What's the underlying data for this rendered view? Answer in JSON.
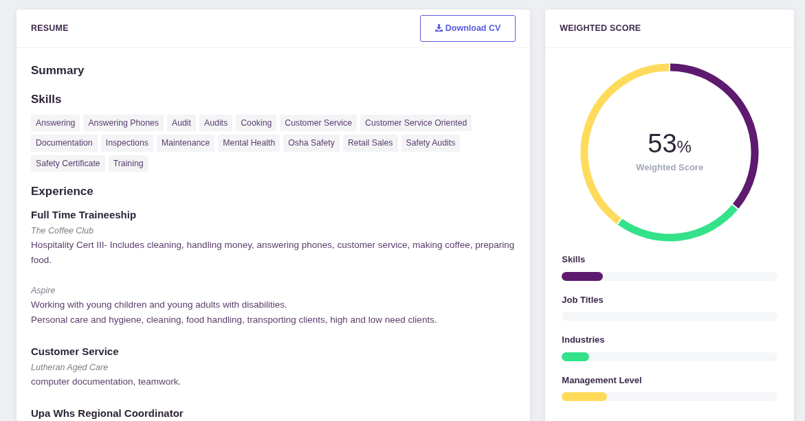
{
  "resume": {
    "title": "RESUME",
    "download_button": "Download CV",
    "sections": [
      {
        "kind": "heading",
        "title": "Summary"
      },
      {
        "kind": "tags",
        "title": "Skills",
        "tags": [
          "Answering",
          "Answering Phones",
          "Audit",
          "Audits",
          "Cooking",
          "Customer Service",
          "Customer Service Oriented",
          "Documentation",
          "Inspections",
          "Maintenance",
          "Mental Health",
          "Osha Safety",
          "Retail Sales",
          "Safety Audits",
          "Safety Certificate",
          "Training"
        ]
      },
      {
        "kind": "experience",
        "title": "Experience",
        "entries": [
          {
            "role": "Full Time Traineeship",
            "company": "The Coffee Club",
            "lines": [
              "Hospitality Cert III- Includes cleaning, handling money, answering phones, customer service, making coffee, preparing food."
            ]
          },
          {
            "company": "Aspire",
            "lines": [
              "Working with young children and young adults with disabilities.",
              "Personal care and hygiene, cleaning, food handling, transporting clients, high and low need clients."
            ]
          },
          {
            "role": "Customer Service",
            "company": "Lutheran Aged Care",
            "lines": [
              "computer documentation, teamwork."
            ]
          },
          {
            "role": "Upa Whs Regional Coordinator"
          }
        ]
      }
    ]
  },
  "weighted_score": {
    "title": "WEIGHTED SCORE",
    "score": "53",
    "unit": "%",
    "caption": "Weighted Score",
    "items": [
      {
        "label": "Skills",
        "level": 0.19,
        "color": "#5e1a6e"
      },
      {
        "label": "Job Titles"
      },
      {
        "label": "Industries",
        "level": 0.125,
        "color": "#34e28a"
      },
      {
        "label": "Management Level",
        "level": 0.21,
        "color": "#ffdb5c"
      }
    ]
  }
}
